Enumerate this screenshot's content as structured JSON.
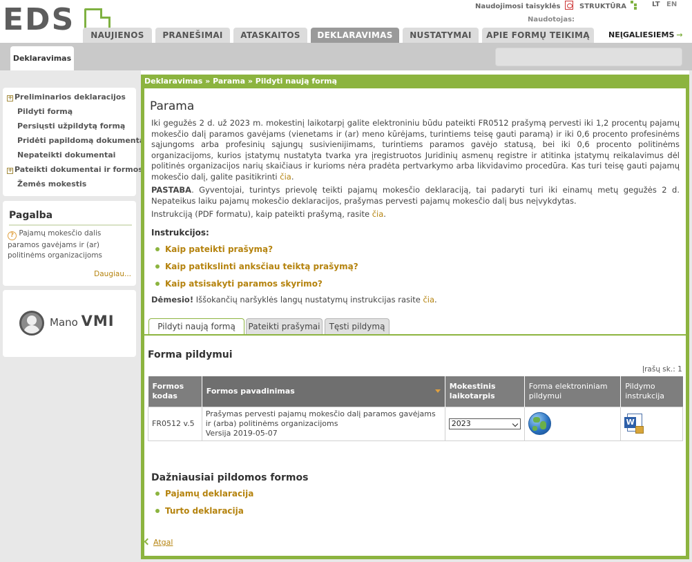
{
  "brand": {
    "logo_text": "EDS"
  },
  "toplinks": {
    "rules": "Naudojimosi taisyklės",
    "structure": "STRUKTŪRA",
    "lang_lt": "LT",
    "lang_en": "EN",
    "user_label": "Naudotojas:"
  },
  "main_tabs": [
    {
      "label": "NAUJIENOS",
      "active": false
    },
    {
      "label": "PRANEŠIMAI",
      "active": false
    },
    {
      "label": "ATASKAITOS",
      "active": false
    },
    {
      "label": "DEKLARAVIMAS",
      "active": true
    },
    {
      "label": "NUSTATYMAI",
      "active": false
    },
    {
      "label": "APIE FORMŲ TEIKIMĄ",
      "active": false
    }
  ],
  "negaliesiems": "NEĮGALIESIEMS",
  "subtab": "Deklaravimas",
  "left_menu": [
    {
      "label": "Preliminarios deklaracijos",
      "expandable": true
    },
    {
      "label": "Pildyti formą",
      "expandable": false
    },
    {
      "label": "Persiųsti užpildytą formą",
      "expandable": false
    },
    {
      "label": "Pridėti papildomą dokumentą",
      "expandable": false
    },
    {
      "label": "Nepateikti dokumentai",
      "expandable": false
    },
    {
      "label": "Pateikti dokumentai ir formos",
      "expandable": true
    },
    {
      "label": "Žemės mokestis",
      "expandable": false
    }
  ],
  "help": {
    "title": "Pagalba",
    "item": "Pajamų mokesčio dalis paramos gavėjams ir (ar) politinėms organizacijoms",
    "more": "Daugiau..."
  },
  "mano_vmi": {
    "prefix": "Mano",
    "suffix": "VMI"
  },
  "breadcrumb": "Deklaravimas » Parama » Pildyti naują formą",
  "page_title": "Parama",
  "intro": {
    "p1": "Iki gegužės 2 d. už 2023 m. mokestinį laikotarpį galite elektroniniu būdu pateikti FR0512 prašymą pervesti iki 1,2 procentų pajamų mokesčio dalį paramos gavėjams (vienetams ir (ar) meno kūrėjams, turintiems teisę gauti paramą) ir iki 0,6 procento profesinėms sąjungoms arba profesinių sąjungų susivienijimams, turintiems paramos gavėjo statusą, bei iki 0,6 procento politinėms organizacijoms, kurios įstatymų nustatyta tvarka yra įregistruotos Juridinių asmenų registre ir atitinka įstatymų reikalavimus dėl politinės organizacijos narių skaičiaus ir kurioms nėra pradėta pertvarkymo arba likvidavimo procedūra. Kas turi teisę gauti pajamų mokesčio dalį, galite pasitikrinti",
    "p1_link": "čia",
    "p2_bold": "PASTABA",
    "p2": ". Gyventojai, turintys prievolę teikti pajamų mokesčio deklaraciją, tai padaryti turi iki einamų metų gegužės 2 d. Nepateikus laiku pajamų mokesčio deklaracijos, prašymas pervesti pajamų mokesčio dalį bus neįvykdytas.",
    "p3": "Instrukciją (PDF formatu), kaip pateikti prašymą, rasite",
    "p3_link": "čia"
  },
  "instructions": {
    "title": "Instrukcijos:",
    "items": [
      "Kaip pateikti prašymą?",
      "Kaip patikslinti anksčiau teiktą prašymą?",
      "Kaip atsisakyti paramos skyrimo?"
    ]
  },
  "demesio": {
    "bold": "Dėmesio!",
    "text": " Iššokančių naršyklės langų nustatymų instrukcijas rasite ",
    "link": "čia"
  },
  "form_tabs": [
    {
      "label": "Pildyti naują formą",
      "active": true
    },
    {
      "label": "Pateikti prašymai",
      "active": false
    },
    {
      "label": "Tęsti pildymą",
      "active": false
    }
  ],
  "forma_title": "Forma pildymui",
  "records_count": "Įrašų sk.: 1",
  "table": {
    "headers": [
      "Formos kodas",
      "Formos pavadinimas",
      "Mokestinis laikotarpis",
      "Forma elektroniniam pildymui",
      "Pildymo instrukcija"
    ],
    "rows": [
      {
        "code": "FR0512 v.5",
        "name_line1": "Prašymas pervesti pajamų mokesčio dalį paramos gavėjams ir (arba) politinėms organizacijoms",
        "name_line2": "Versija 2019-05-07",
        "period": "2023",
        "form_icon": "globe-icon",
        "instr_icon": "word-document-icon"
      }
    ]
  },
  "frequent": {
    "title": "Dažniausiai pildomos formos",
    "items": [
      "Pajamų deklaracija",
      "Turto deklaracija"
    ]
  },
  "back_link": "Atgal",
  "colors": {
    "accent_green": "#8cb43f",
    "link_gold": "#b5830e",
    "tab_gray": "#dcdcdc"
  }
}
